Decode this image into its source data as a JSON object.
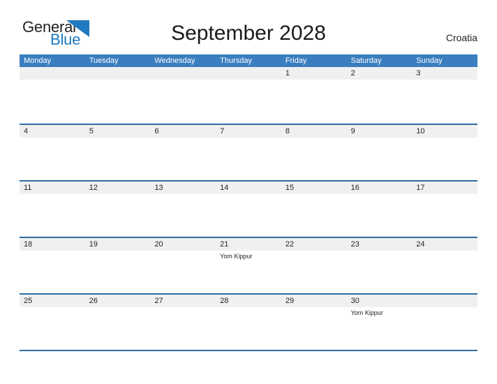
{
  "brand": {
    "name_part1": "General",
    "name_part2": "Blue",
    "flag_icon": "blue-triangle-flag-icon",
    "color_dark": "#231f20",
    "color_blue": "#1f7ac0"
  },
  "header": {
    "title": "September 2028",
    "locale": "Croatia"
  },
  "theme": {
    "header_blue": "#3a7ebf",
    "rule_blue": "#2e6da4",
    "band_gray": "#f0f0f0",
    "text_dark": "#231f20",
    "page_background": "#ffffff"
  },
  "calendar": {
    "month": "September",
    "year": "2028",
    "weekday_headers": [
      "Monday",
      "Tuesday",
      "Wednesday",
      "Thursday",
      "Friday",
      "Saturday",
      "Sunday"
    ],
    "weeks": [
      {
        "days": [
          {
            "num": "",
            "events": []
          },
          {
            "num": "",
            "events": []
          },
          {
            "num": "",
            "events": []
          },
          {
            "num": "",
            "events": []
          },
          {
            "num": "1",
            "events": []
          },
          {
            "num": "2",
            "events": []
          },
          {
            "num": "3",
            "events": []
          }
        ]
      },
      {
        "days": [
          {
            "num": "4",
            "events": []
          },
          {
            "num": "5",
            "events": []
          },
          {
            "num": "6",
            "events": []
          },
          {
            "num": "7",
            "events": []
          },
          {
            "num": "8",
            "events": []
          },
          {
            "num": "9",
            "events": []
          },
          {
            "num": "10",
            "events": []
          }
        ]
      },
      {
        "days": [
          {
            "num": "11",
            "events": []
          },
          {
            "num": "12",
            "events": []
          },
          {
            "num": "13",
            "events": []
          },
          {
            "num": "14",
            "events": []
          },
          {
            "num": "15",
            "events": []
          },
          {
            "num": "16",
            "events": []
          },
          {
            "num": "17",
            "events": []
          }
        ]
      },
      {
        "days": [
          {
            "num": "18",
            "events": []
          },
          {
            "num": "19",
            "events": []
          },
          {
            "num": "20",
            "events": []
          },
          {
            "num": "21",
            "events": [
              "Yom Kippur"
            ]
          },
          {
            "num": "22",
            "events": []
          },
          {
            "num": "23",
            "events": []
          },
          {
            "num": "24",
            "events": []
          }
        ]
      },
      {
        "days": [
          {
            "num": "25",
            "events": []
          },
          {
            "num": "26",
            "events": []
          },
          {
            "num": "27",
            "events": []
          },
          {
            "num": "28",
            "events": []
          },
          {
            "num": "29",
            "events": []
          },
          {
            "num": "30",
            "events": [
              "Yom Kippur"
            ]
          },
          {
            "num": "",
            "events": []
          }
        ]
      }
    ]
  }
}
